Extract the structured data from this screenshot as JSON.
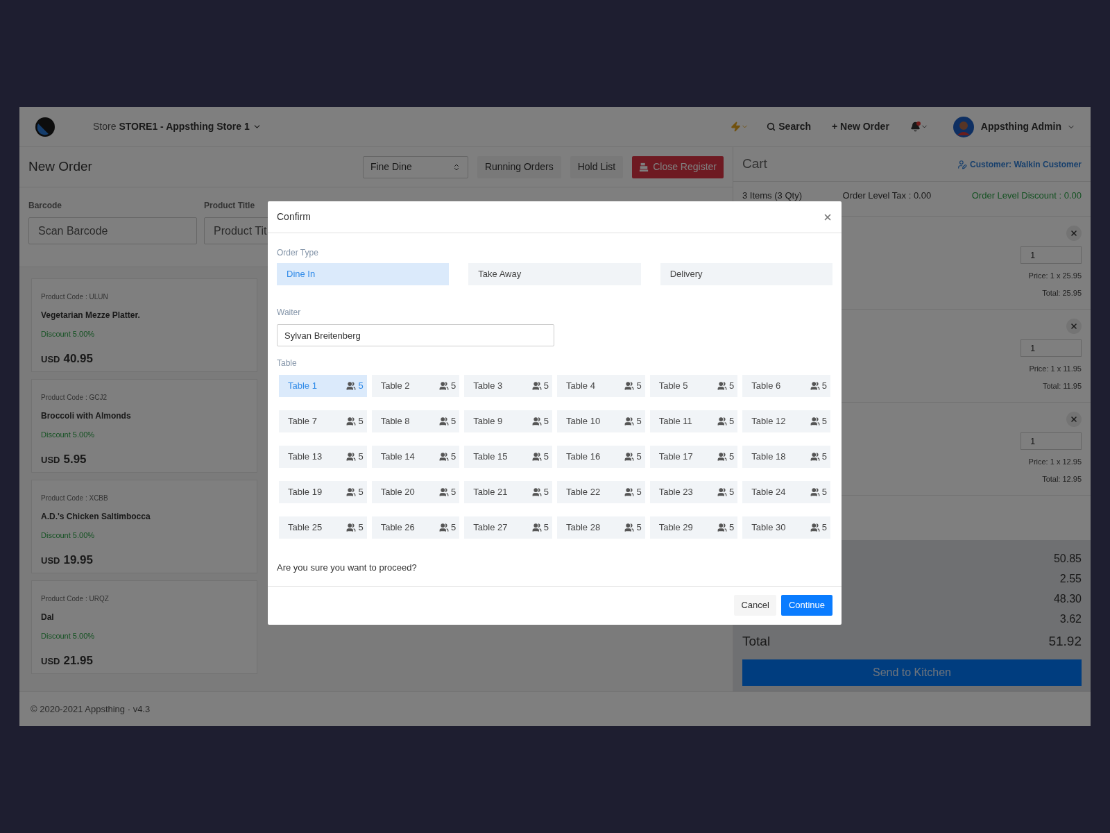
{
  "header": {
    "store_label": "Store",
    "store_name": "STORE1 - Appsthing Store 1",
    "search": "Search",
    "new_order": "+ New Order",
    "user": "Appsthing Admin"
  },
  "toolbar": {
    "title": "New Order",
    "order_mode": "Fine Dine",
    "buttons": [
      {
        "label": "Running Orders",
        "kind": "plain"
      },
      {
        "label": "Hold List",
        "kind": "plain"
      },
      {
        "label": "Close Register",
        "kind": "danger"
      }
    ]
  },
  "filters": [
    {
      "label": "Barcode",
      "placeholder": "Scan Barcode"
    },
    {
      "label": "Product Title",
      "placeholder": "Product Tit"
    }
  ],
  "products": [
    {
      "code": "Product Code : ULUN",
      "name": "Vegetarian Mezze Platter.",
      "discount": "Discount 5.00%",
      "currency": "USD",
      "price": "40.95"
    },
    {
      "code": "Product Code : GCJ2",
      "name": "Broccoli with Almonds",
      "discount": "Discount 5.00%",
      "currency": "USD",
      "price": "5.95"
    },
    {
      "code": "Product Code : XCBB",
      "name": "A.D.'s Chicken Saltimbocca",
      "discount": "Discount 5.00%",
      "currency": "USD",
      "price": "19.95"
    },
    {
      "code": "Product Code : URQZ",
      "name": "Dal",
      "discount": "Discount 5.00%",
      "currency": "USD",
      "price": "21.95"
    }
  ],
  "footer": "© 2020-2021 Appsthing · v4.3",
  "cart": {
    "title": "Cart",
    "customer": "Customer: Walkin Customer",
    "count": "3 Items (3 Qty)",
    "tax": "Order Level Tax : 0.00",
    "discount": "Order Level Discount : 0.00",
    "items": [
      {
        "qty": "1",
        "price": "Price: 1 x 25.95",
        "total": "Total: 25.95"
      },
      {
        "qty": "1",
        "price": "Price: 1 x 11.95",
        "total": "Total: 11.95"
      },
      {
        "qty": "1",
        "price": "Price: 1 x 12.95",
        "total": "Total: 12.95"
      }
    ],
    "summary": [
      "50.85",
      "2.55",
      "48.30",
      "3.62"
    ],
    "total_label": "Total",
    "total": "51.92",
    "send": "Send to Kitchen"
  },
  "dialog": {
    "title": "Confirm",
    "order_type_label": "Order Type",
    "order_types": [
      {
        "label": "Dine In",
        "selected": true
      },
      {
        "label": "Take Away",
        "selected": false
      },
      {
        "label": "Delivery",
        "selected": false
      }
    ],
    "waiter_label": "Waiter",
    "waiter": "Sylvan Breitenberg",
    "table_label": "Table",
    "tables": [
      {
        "name": "Table 1",
        "seats": "5",
        "selected": true
      },
      {
        "name": "Table 2",
        "seats": "5",
        "selected": false
      },
      {
        "name": "Table 3",
        "seats": "5",
        "selected": false
      },
      {
        "name": "Table 4",
        "seats": "5",
        "selected": false
      },
      {
        "name": "Table 5",
        "seats": "5",
        "selected": false
      },
      {
        "name": "Table 6",
        "seats": "5",
        "selected": false
      },
      {
        "name": "Table 7",
        "seats": "5",
        "selected": false
      },
      {
        "name": "Table 8",
        "seats": "5",
        "selected": false
      },
      {
        "name": "Table 9",
        "seats": "5",
        "selected": false
      },
      {
        "name": "Table 10",
        "seats": "5",
        "selected": false
      },
      {
        "name": "Table 11",
        "seats": "5",
        "selected": false
      },
      {
        "name": "Table 12",
        "seats": "5",
        "selected": false
      },
      {
        "name": "Table 13",
        "seats": "5",
        "selected": false
      },
      {
        "name": "Table 14",
        "seats": "5",
        "selected": false
      },
      {
        "name": "Table 15",
        "seats": "5",
        "selected": false
      },
      {
        "name": "Table 16",
        "seats": "5",
        "selected": false
      },
      {
        "name": "Table 17",
        "seats": "5",
        "selected": false
      },
      {
        "name": "Table 18",
        "seats": "5",
        "selected": false
      },
      {
        "name": "Table 19",
        "seats": "5",
        "selected": false
      },
      {
        "name": "Table 20",
        "seats": "5",
        "selected": false
      },
      {
        "name": "Table 21",
        "seats": "5",
        "selected": false
      },
      {
        "name": "Table 22",
        "seats": "5",
        "selected": false
      },
      {
        "name": "Table 23",
        "seats": "5",
        "selected": false
      },
      {
        "name": "Table 24",
        "seats": "5",
        "selected": false
      },
      {
        "name": "Table 25",
        "seats": "5",
        "selected": false
      },
      {
        "name": "Table 26",
        "seats": "5",
        "selected": false
      },
      {
        "name": "Table 27",
        "seats": "5",
        "selected": false
      },
      {
        "name": "Table 28",
        "seats": "5",
        "selected": false
      },
      {
        "name": "Table 29",
        "seats": "5",
        "selected": false
      },
      {
        "name": "Table 30",
        "seats": "5",
        "selected": false
      }
    ],
    "question": "Are you sure you want to proceed?",
    "cancel": "Cancel",
    "continue": "Continue"
  }
}
